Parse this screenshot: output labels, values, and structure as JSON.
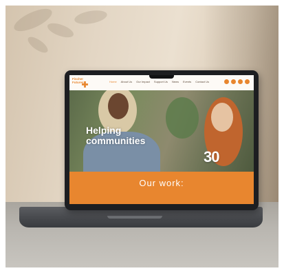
{
  "website": {
    "logo_text": "Fischer\nFutures",
    "nav_items": [
      {
        "label": "Home",
        "active": true
      },
      {
        "label": "About Us",
        "active": false
      },
      {
        "label": "Our Impact",
        "active": false
      },
      {
        "label": "Support Us",
        "active": false
      },
      {
        "label": "News",
        "active": false
      },
      {
        "label": "Events",
        "active": false
      },
      {
        "label": "Contact Us",
        "active": false
      }
    ],
    "hero_title": "Helping\ncommunities",
    "badge": "30",
    "banner_text": "Our work:"
  },
  "colors": {
    "brand_orange": "#e8862f",
    "screen_bezel": "#1d1e21",
    "wall": "#e3d6c4",
    "table": "#b9b6b0"
  },
  "icons": [
    "logo-cross-icon",
    "social-icon",
    "social-icon",
    "social-icon",
    "social-icon"
  ]
}
